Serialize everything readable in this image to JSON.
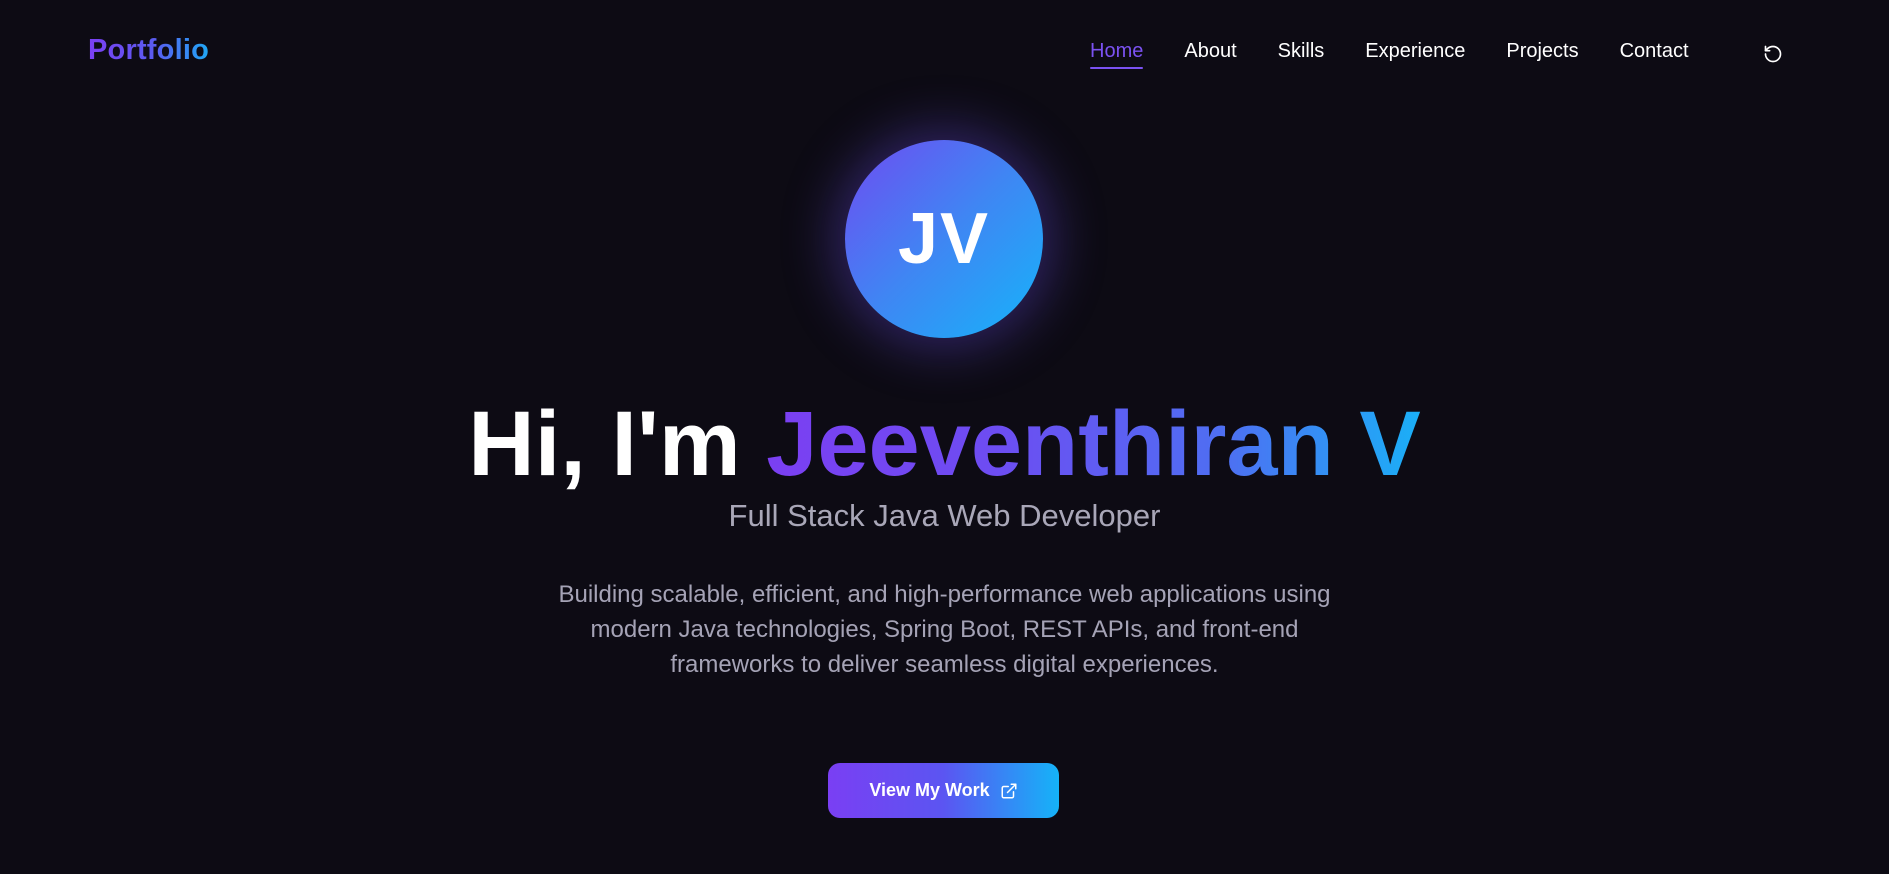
{
  "nav": {
    "logo": "Portfolio",
    "links": [
      {
        "label": "Home",
        "active": true
      },
      {
        "label": "About"
      },
      {
        "label": "Skills"
      },
      {
        "label": "Experience"
      },
      {
        "label": "Projects"
      },
      {
        "label": "Contact"
      }
    ],
    "theme_toggle_icon": "theme-toggle-icon"
  },
  "hero": {
    "avatar_initials": "JV",
    "headline_prefix": "Hi, I'm ",
    "headline_name": "Jeeventhiran V",
    "subtitle": "Full Stack Java Web Developer",
    "description": "Building scalable, efficient, and high-performance web applications using modern Java technologies, Spring Boot, REST APIs, and front-end frameworks to deliver seamless digital experiences.",
    "cta_label": "View My Work",
    "cta_icon": "external-link-icon"
  },
  "colors": {
    "background": "#0d0b14",
    "accent_purple": "#7b3ff2",
    "accent_blue": "#1ab0f7",
    "text_muted": "#a9a7b8"
  }
}
